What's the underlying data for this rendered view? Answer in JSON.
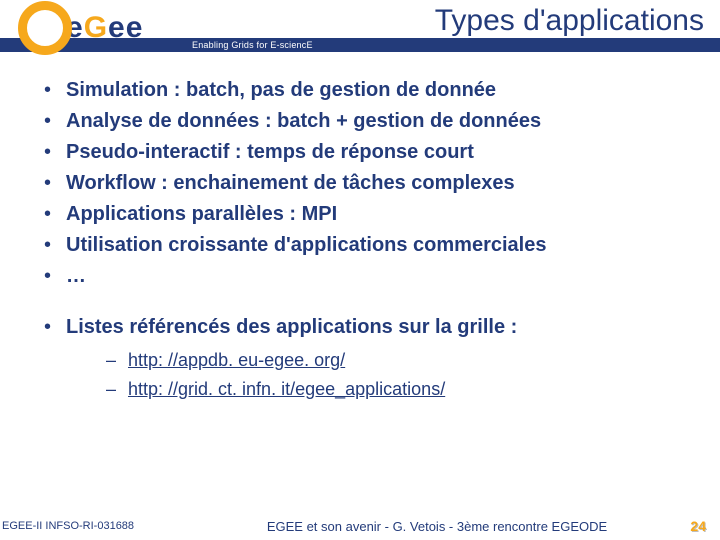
{
  "header": {
    "logo_letters": [
      "e",
      "G",
      "e",
      "e"
    ],
    "title": "Types d'applications",
    "tagline": "Enabling Grids for E-sciencE"
  },
  "bullets": {
    "group1": [
      "Simulation : batch, pas de gestion de donnée",
      "Analyse de données : batch + gestion de données",
      "Pseudo-interactif : temps de réponse court",
      "Workflow : enchainement de tâches complexes",
      "Applications parallèles : MPI",
      "Utilisation croissante d'applications commerciales",
      "…"
    ],
    "group2_intro": "Listes référencés des applications sur la grille :",
    "group2_links": [
      "http: //appdb. eu-egee. org/",
      "http: //grid. ct. infn. it/egee_applications/"
    ]
  },
  "footer": {
    "left": "EGEE-II INFSO-RI-031688",
    "mid": "EGEE et son avenir - G. Vetois - 3ème rencontre EGEODE",
    "page": "24"
  }
}
